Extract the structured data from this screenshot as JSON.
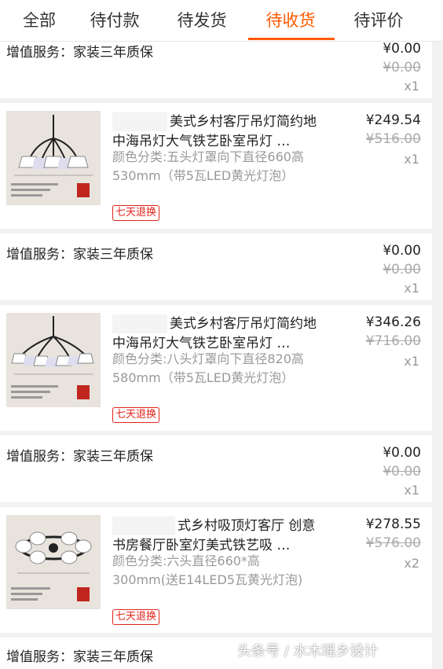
{
  "tabs": [
    "全部",
    "待付款",
    "待发货",
    "待收货",
    "待评价"
  ],
  "service": {
    "label": "增值服务：家装三年质保",
    "label_cut": "增值服务：家装三年质保",
    "price_now": "¥0.00",
    "price_old": "¥0.00",
    "qty": "x1"
  },
  "items": [
    {
      "title": "美式乡村客厅吊灯简约地中海吊灯大气铁艺卧室吊灯 …",
      "sku": "颜色分类:五头灯罩向下直径660高530mm（带5瓦LED黄光灯泡）",
      "badge": "七天退换",
      "price_now": "¥249.54",
      "price_old": "¥516.00",
      "qty": "x1"
    },
    {
      "title": "美式乡村客厅吊灯简约地中海吊灯大气铁艺卧室吊灯 …",
      "sku": "颜色分类:八头灯罩向下直径820高580mm（带5瓦LED黄光灯泡）",
      "badge": "七天退换",
      "price_now": "¥346.26",
      "price_old": "¥716.00",
      "qty": "x1"
    },
    {
      "title": "式乡村吸顶灯客厅 创意书房餐厅卧室灯美式铁艺吸 …",
      "sku": "颜色分类:六头直径660*高300mm(送E14LED5瓦黄光灯泡)",
      "badge": "七天退换",
      "price_now": "¥278.55",
      "price_old": "¥576.00",
      "qty": "x2"
    }
  ],
  "watermark": "头条号 / 水木瑶乡设计"
}
